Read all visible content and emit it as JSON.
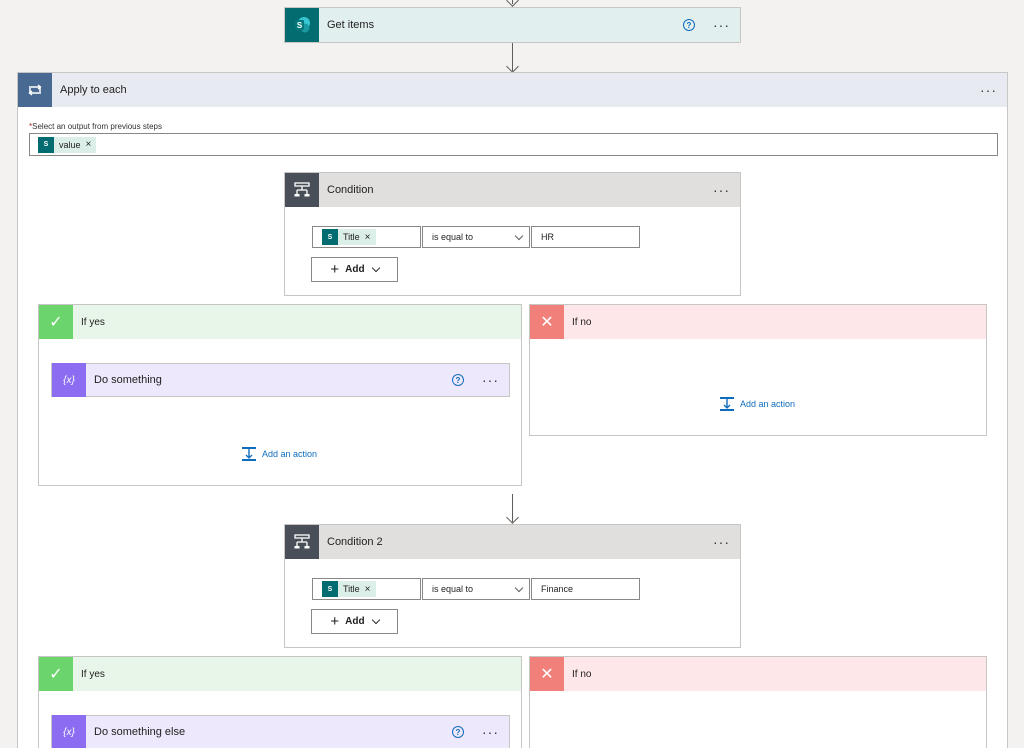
{
  "get_items": {
    "title": "Get items",
    "help": "?",
    "more": "···"
  },
  "apply_each": {
    "title": "Apply to each",
    "more": "···",
    "required_mark": "*",
    "field_label": "Select an output from previous steps",
    "token": "value",
    "token_remove": "×"
  },
  "conditions": [
    {
      "title": "Condition",
      "more": "···",
      "left_token": "Title",
      "token_remove": "×",
      "operator": "is equal to",
      "value": "HR",
      "add_label": "Add",
      "yes": {
        "label": "If yes",
        "action_title": "Do something",
        "add_action": "Add an action"
      },
      "no": {
        "label": "If no",
        "add_action": "Add an action"
      }
    },
    {
      "title": "Condition 2",
      "more": "···",
      "left_token": "Title",
      "token_remove": "×",
      "operator": "is equal to",
      "value": "Finance",
      "add_label": "Add",
      "yes": {
        "label": "If yes",
        "action_title": "Do something else"
      },
      "no": {
        "label": "If no"
      }
    }
  ],
  "icons": {
    "sharepoint": "sharepoint-icon",
    "loop": "loop-icon",
    "condition": "condition-icon",
    "check": "check-icon",
    "close": "close-icon",
    "variable": "variable-icon",
    "add_action": "add-action-icon"
  },
  "glyphs": {
    "sp_letter": "S",
    "check": "✓",
    "cross": "✕",
    "var": "{x}",
    "plus": "+"
  },
  "colors": {
    "sharepoint": "#036c70",
    "loop": "#486991",
    "condition": "#484f58",
    "yes": "#6bd46d",
    "no": "#f1807b",
    "variable": "#8c6cf0",
    "link": "#0f6cbd"
  }
}
